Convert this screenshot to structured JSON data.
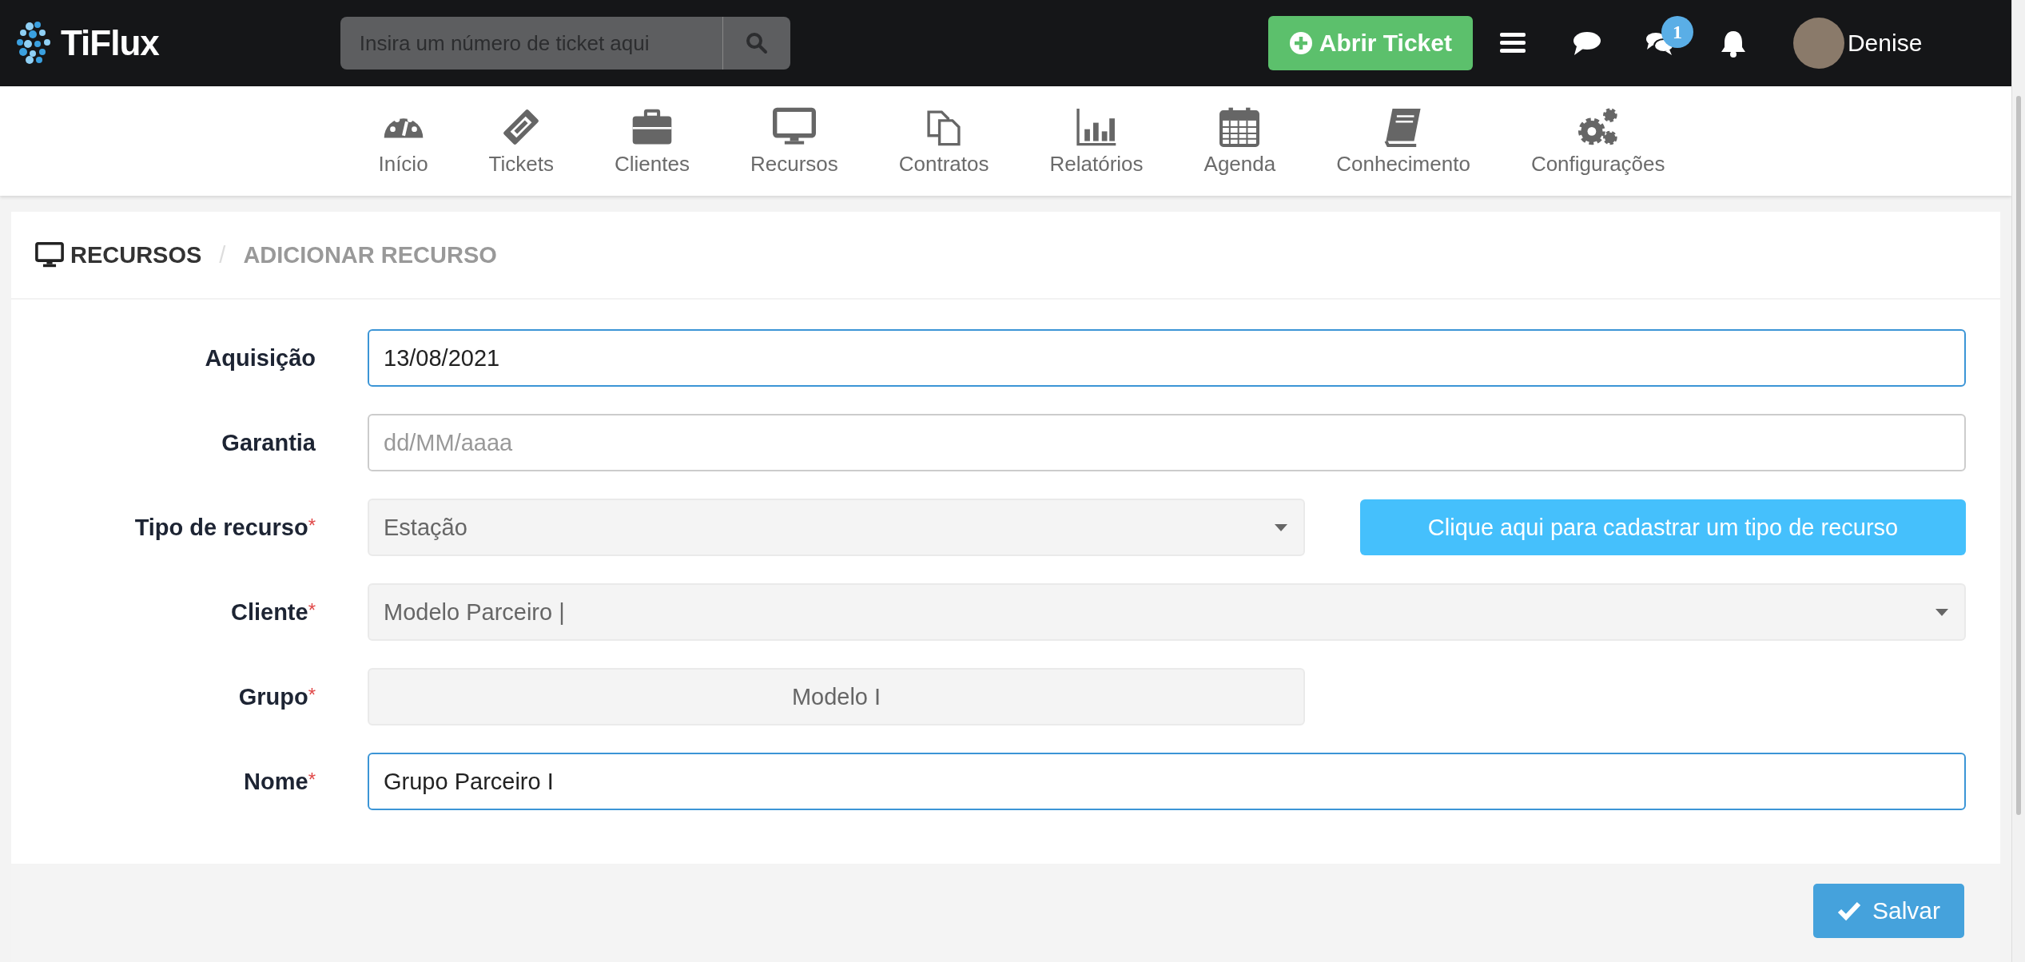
{
  "topbar": {
    "logo": "TiFlux",
    "search": {
      "placeholder": "Insira um número de ticket aqui"
    },
    "open_ticket_button": "Abrir Ticket",
    "chats_badge": "1",
    "user": "Denise"
  },
  "nav": [
    {
      "label": "Início",
      "selected": false
    },
    {
      "label": "Tickets",
      "selected": false
    },
    {
      "label": "Clientes",
      "selected": false
    },
    {
      "label": "Recursos",
      "selected": false
    },
    {
      "label": "Contratos",
      "selected": false
    },
    {
      "label": "Relatórios",
      "selected": false
    },
    {
      "label": "Agenda",
      "selected": false
    },
    {
      "label": "Conhecimento",
      "selected": false
    },
    {
      "label": "Configurações",
      "selected": false
    }
  ],
  "breadcrumb": [
    {
      "label": "RECURSOS"
    },
    {
      "label": "ADICIONAR RECURSO"
    }
  ],
  "breadcrumb_separator": "/",
  "required_mark": "*",
  "fields": [
    {
      "kind": "text",
      "label": "Aquisição",
      "required": false,
      "value": "13/08/2021",
      "focused": true
    },
    {
      "kind": "text",
      "label": "Garantia",
      "required": false,
      "placeholder": "dd/MM/aaaa",
      "focused": false
    },
    {
      "kind": "select",
      "label": "Tipo de recurso",
      "required": true,
      "value": "Estação",
      "half": true,
      "action_button": "Clique aqui para cadastrar um tipo de recurso"
    },
    {
      "kind": "select",
      "label": "Cliente",
      "required": true,
      "value": "Modelo Parceiro |"
    },
    {
      "kind": "readonly",
      "label": "Grupo",
      "required": true,
      "value": "Modelo I",
      "half": true
    },
    {
      "kind": "text",
      "label": "Nome",
      "required": true,
      "value": "Grupo Parceiro I",
      "focused": true
    }
  ],
  "save_button": "Salvar"
}
